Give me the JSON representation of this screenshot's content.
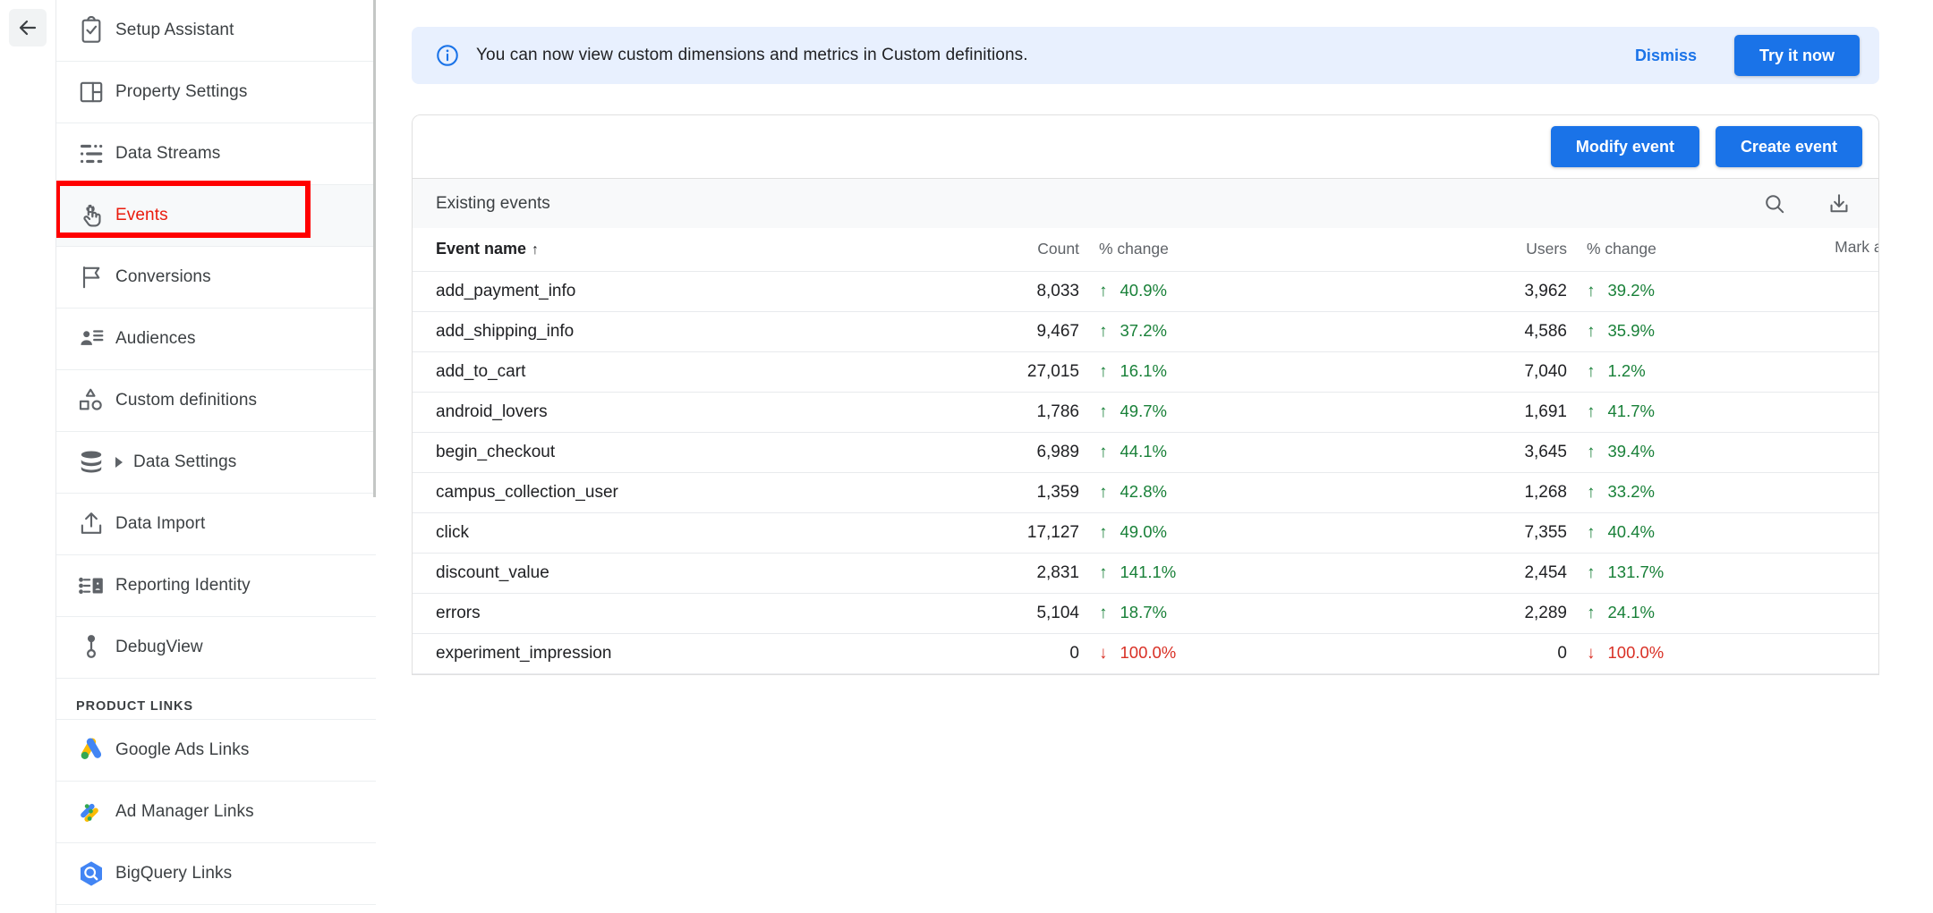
{
  "colors": {
    "accent": "#1a73e8",
    "banner_bg": "#e8f0fe",
    "selected_red": "#ea1c0d",
    "highlight_red": "#ff0000",
    "positive_green": "#188038",
    "negative_red": "#d93025"
  },
  "back_button": {
    "icon": "arrow-back-icon"
  },
  "sidebar": {
    "items": [
      {
        "label": "Setup Assistant",
        "icon": "clipboard-check-icon",
        "selected": false,
        "expandable": false
      },
      {
        "label": "Property Settings",
        "icon": "property-panel-icon",
        "selected": false,
        "expandable": false
      },
      {
        "label": "Data Streams",
        "icon": "data-streams-icon",
        "selected": false,
        "expandable": false
      },
      {
        "label": "Events",
        "icon": "tap-hand-icon",
        "selected": true,
        "expandable": false
      },
      {
        "label": "Conversions",
        "icon": "flag-icon",
        "selected": false,
        "expandable": false
      },
      {
        "label": "Audiences",
        "icon": "audiences-icon",
        "selected": false,
        "expandable": false
      },
      {
        "label": "Custom definitions",
        "icon": "shapes-icon",
        "selected": false,
        "expandable": false
      },
      {
        "label": "Data Settings",
        "icon": "database-icon",
        "selected": false,
        "expandable": true
      },
      {
        "label": "Data Import",
        "icon": "upload-icon",
        "selected": false,
        "expandable": false
      },
      {
        "label": "Reporting Identity",
        "icon": "reporting-identity-icon",
        "selected": false,
        "expandable": false
      },
      {
        "label": "DebugView",
        "icon": "debugview-icon",
        "selected": false,
        "expandable": false
      }
    ],
    "product_links_header": "PRODUCT LINKS",
    "product_links": [
      {
        "label": "Google Ads Links",
        "icon": "google-ads-icon"
      },
      {
        "label": "Ad Manager Links",
        "icon": "ad-manager-icon"
      },
      {
        "label": "BigQuery Links",
        "icon": "bigquery-icon"
      }
    ]
  },
  "banner": {
    "icon": "info-circle-icon",
    "message": "You can now view custom dimensions and metrics in Custom definitions.",
    "dismiss_label": "Dismiss",
    "cta_label": "Try it now"
  },
  "toolbar": {
    "modify_event_label": "Modify event",
    "create_event_label": "Create event"
  },
  "table": {
    "title": "Existing events",
    "search_icon": "search-icon",
    "download_icon": "download-icon",
    "headers": {
      "event_name": "Event name",
      "sort_indicator": "↑",
      "count": "Count",
      "count_change": "% change",
      "users": "Users",
      "users_change": "% change",
      "mark_as_conversion": "Mark as conversion",
      "help_glyph": "?"
    },
    "rows": [
      {
        "name": "add_payment_info",
        "count": "8,033",
        "count_change": "40.9%",
        "count_dir": "up",
        "users": "3,962",
        "users_change": "39.2%",
        "users_dir": "up",
        "conversion": true,
        "highlighted": true
      },
      {
        "name": "add_shipping_info",
        "count": "9,467",
        "count_change": "37.2%",
        "count_dir": "up",
        "users": "4,586",
        "users_change": "35.9%",
        "users_dir": "up",
        "conversion": false,
        "highlighted": false
      },
      {
        "name": "add_to_cart",
        "count": "27,015",
        "count_change": "16.1%",
        "count_dir": "up",
        "users": "7,040",
        "users_change": "1.2%",
        "users_dir": "up",
        "conversion": false,
        "highlighted": false
      },
      {
        "name": "android_lovers",
        "count": "1,786",
        "count_change": "49.7%",
        "count_dir": "up",
        "users": "1,691",
        "users_change": "41.7%",
        "users_dir": "up",
        "conversion": false,
        "highlighted": false
      },
      {
        "name": "begin_checkout",
        "count": "6,989",
        "count_change": "44.1%",
        "count_dir": "up",
        "users": "3,645",
        "users_change": "39.4%",
        "users_dir": "up",
        "conversion": true,
        "highlighted": false
      },
      {
        "name": "campus_collection_user",
        "count": "1,359",
        "count_change": "42.8%",
        "count_dir": "up",
        "users": "1,268",
        "users_change": "33.2%",
        "users_dir": "up",
        "conversion": false,
        "highlighted": false
      },
      {
        "name": "click",
        "count": "17,127",
        "count_change": "49.0%",
        "count_dir": "up",
        "users": "7,355",
        "users_change": "40.4%",
        "users_dir": "up",
        "conversion": false,
        "highlighted": false
      },
      {
        "name": "discount_value",
        "count": "2,831",
        "count_change": "141.1%",
        "count_dir": "up",
        "users": "2,454",
        "users_change": "131.7%",
        "users_dir": "up",
        "conversion": false,
        "highlighted": false
      },
      {
        "name": "errors",
        "count": "5,104",
        "count_change": "18.7%",
        "count_dir": "up",
        "users": "2,289",
        "users_change": "24.1%",
        "users_dir": "up",
        "conversion": false,
        "highlighted": false
      },
      {
        "name": "experiment_impression",
        "count": "0",
        "count_change": "100.0%",
        "count_dir": "down",
        "users": "0",
        "users_change": "100.0%",
        "users_dir": "down",
        "conversion": false,
        "highlighted": false
      }
    ]
  }
}
